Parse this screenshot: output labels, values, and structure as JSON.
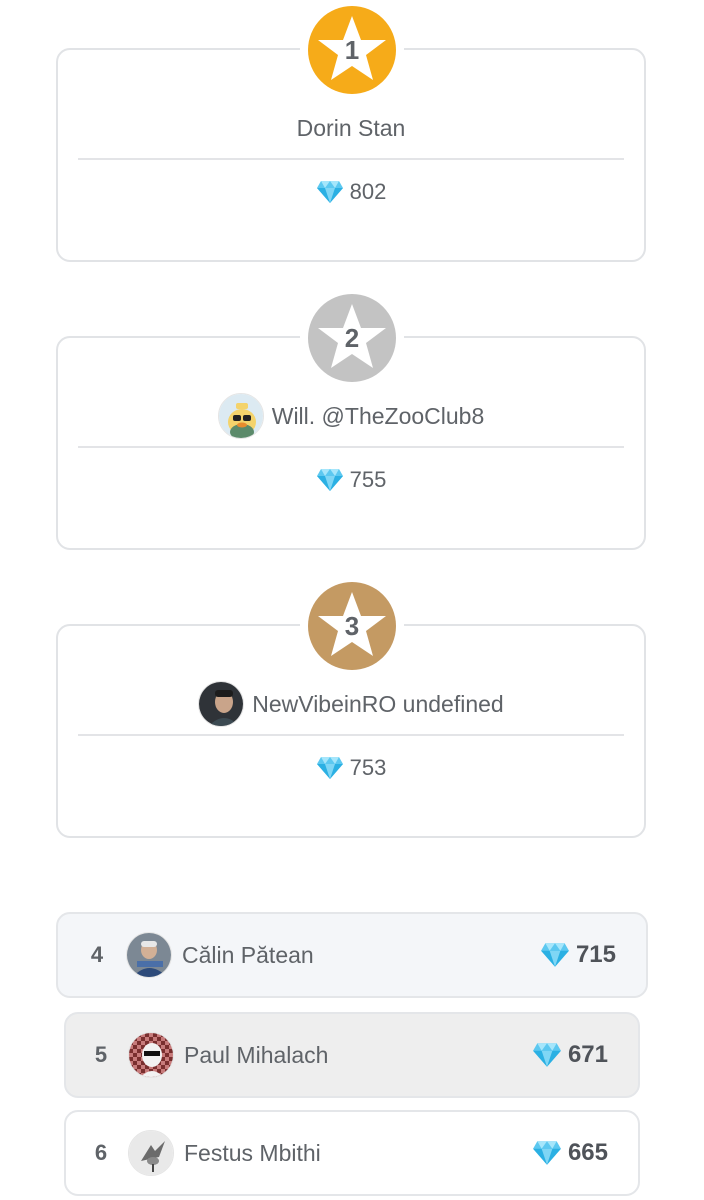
{
  "podium": [
    {
      "rank": "1",
      "name": "Dorin Stan",
      "score": "802",
      "medal_color": "#f6ab19",
      "has_avatar": false
    },
    {
      "rank": "2",
      "name": "Will. @TheZooClub8",
      "score": "755",
      "medal_color": "#c3c3c3",
      "has_avatar": true,
      "avatar": "duck-avatar"
    },
    {
      "rank": "3",
      "name": "NewVibeinRO undefined",
      "score": "753",
      "medal_color": "#c49a63",
      "has_avatar": true,
      "avatar": "photo-avatar"
    }
  ],
  "list": [
    {
      "rank": "4",
      "name": "Călin Pătean",
      "score": "715",
      "avatar": "photo-avatar"
    },
    {
      "rank": "5",
      "name": "Paul Mihalach",
      "score": "671",
      "avatar": "cartoon-avatar"
    },
    {
      "rank": "6",
      "name": "Festus Mbithi",
      "score": "665",
      "avatar": "bird-avatar"
    }
  ],
  "icons": {
    "gem": "diamond-icon",
    "medal": "star-icon"
  },
  "colors": {
    "gem_light": "#7fd6f5",
    "gem_dark": "#1aa3d9"
  }
}
